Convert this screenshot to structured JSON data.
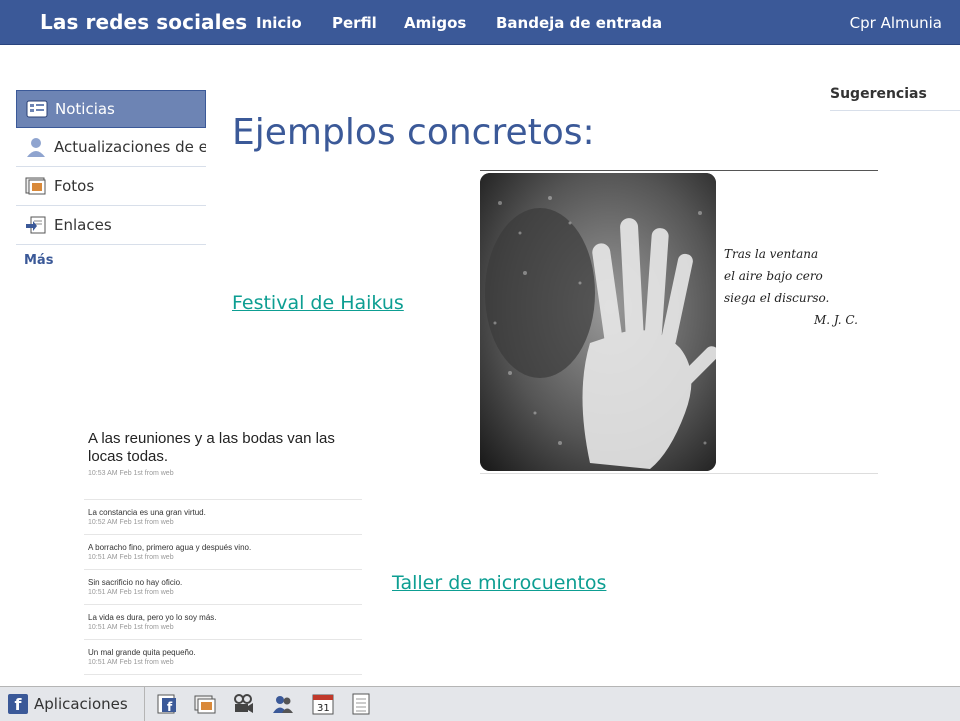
{
  "topbar": {
    "brand": "Las redes sociales",
    "nav": [
      "Inicio",
      "Perfil",
      "Amigos",
      "Bandeja de entrada"
    ],
    "user": "Cpr Almunia"
  },
  "sidebar": {
    "items": [
      {
        "label": "Noticias",
        "icon": "news-feed-icon",
        "active": true
      },
      {
        "label": "Actualizaciones de estado",
        "icon": "person-icon"
      },
      {
        "label": "Fotos",
        "icon": "photos-icon"
      },
      {
        "label": "Enlaces",
        "icon": "links-icon"
      }
    ],
    "more": "Más"
  },
  "suggestions": {
    "title": "Sugerencias"
  },
  "main": {
    "title": "Ejemplos concretos:",
    "link_haikus": "Festival de Haikus",
    "link_micro": "Taller de microcuentos"
  },
  "haiku": {
    "lines": [
      "Tras la ventana",
      "el aire bajo cero",
      "siega el discurso."
    ],
    "signature": "M. J. C."
  },
  "tweets": {
    "main": {
      "text": "A las reuniones y a las bodas van las locas todas.",
      "meta": "10:53 AM Feb 1st from web"
    },
    "items": [
      {
        "text": "La constancia es una gran virtud.",
        "meta": "10:52 AM Feb 1st from web"
      },
      {
        "text": "A borracho fino, primero agua y después vino.",
        "meta": "10:51 AM Feb 1st from web"
      },
      {
        "text": "Sin sacrificio no hay oficio.",
        "meta": "10:51 AM Feb 1st from web"
      },
      {
        "text": "La vida es dura, pero yo lo soy más.",
        "meta": "10:51 AM Feb 1st from web"
      },
      {
        "text": "Un mal grande quita pequeño.",
        "meta": "10:51 AM Feb 1st from web"
      }
    ]
  },
  "bottombar": {
    "apps_label": "Aplicaciones",
    "calendar_day": "31",
    "icons": [
      "fb-app-icon",
      "photos-app-icon",
      "video-icon",
      "friends-icon",
      "calendar-icon",
      "notes-icon"
    ]
  }
}
